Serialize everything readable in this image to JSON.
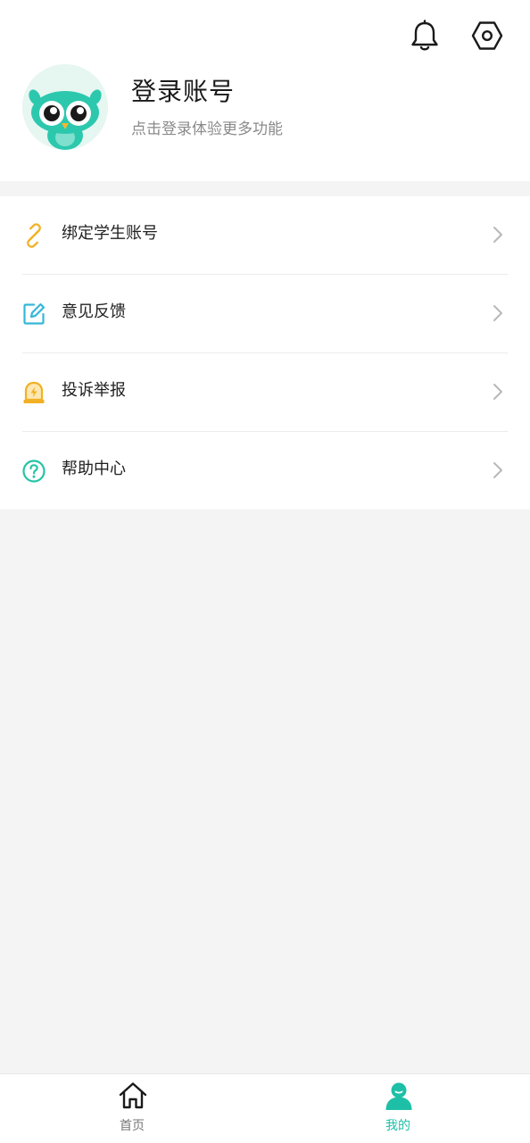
{
  "header": {
    "title": "登录账号",
    "subtitle": "点击登录体验更多功能"
  },
  "menu": {
    "items": [
      {
        "label": "绑定学生账号",
        "icon": "link-icon",
        "color": "#f2b124"
      },
      {
        "label": "意见反馈",
        "icon": "edit-icon",
        "color": "#35b7d8"
      },
      {
        "label": "投诉举报",
        "icon": "alarm-icon",
        "color": "#f2b124"
      },
      {
        "label": "帮助中心",
        "icon": "help-icon",
        "color": "#24c4a4"
      }
    ]
  },
  "tabbar": {
    "home_label": "首页",
    "mine_label": "我的",
    "active": "mine",
    "accent_color": "#1ebfa7"
  }
}
